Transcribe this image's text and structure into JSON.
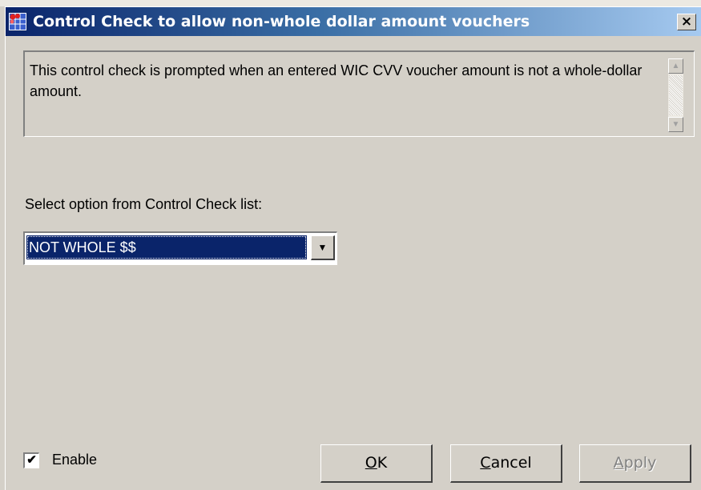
{
  "window": {
    "title": "Control Check to allow non-whole dollar amount vouchers",
    "close_symbol": "×",
    "app_icon": "app-grid-icon"
  },
  "description": {
    "text": "This control check is prompted when an entered WIC CVV voucher amount is not a whole-dollar amount."
  },
  "scrollbar": {
    "up_symbol": "▲",
    "down_symbol": "▼"
  },
  "control_check": {
    "label": "Select option from Control Check list:",
    "selected_value": "NOT WHOLE $$",
    "dropdown_symbol": "▼"
  },
  "enable": {
    "label": "Enable",
    "checked": true,
    "check_symbol": "✔"
  },
  "buttons": {
    "ok_accel": "O",
    "ok_rest": "K",
    "cancel_accel": "C",
    "cancel_rest": "ancel",
    "apply_accel": "A",
    "apply_rest": "pply"
  },
  "colors": {
    "titlebar_start": "#0a246a",
    "titlebar_end": "#a6caf0",
    "face": "#d4d0c8",
    "selection": "#0a246a"
  }
}
